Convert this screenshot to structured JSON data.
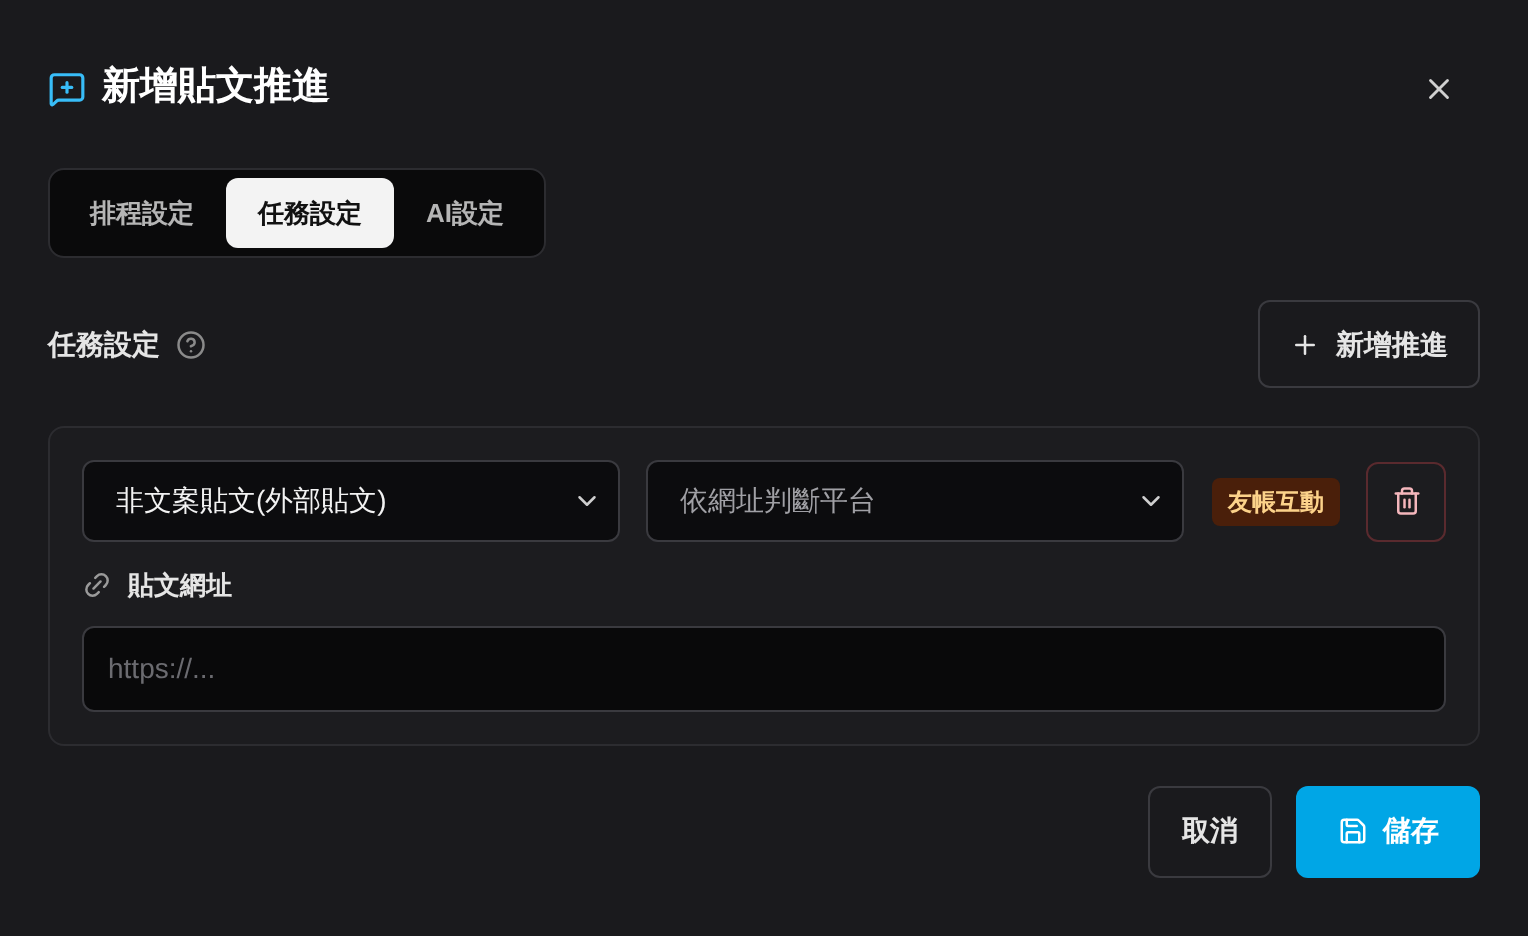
{
  "dialog": {
    "title": "新增貼文推進"
  },
  "tabs": [
    {
      "label": "排程設定",
      "selected": false
    },
    {
      "label": "任務設定",
      "selected": true
    },
    {
      "label": "AI設定",
      "selected": false
    }
  ],
  "section": {
    "title": "任務設定",
    "add_button": "新增推進"
  },
  "tasks": [
    {
      "type_select": {
        "value": "非文案貼文(外部貼文)"
      },
      "platform_select": {
        "placeholder": "依網址判斷平台"
      },
      "badge": "友帳互動",
      "url_label": "貼文網址",
      "url_field": {
        "placeholder": "https://..."
      }
    }
  ],
  "buttons": {
    "cancel": "取消",
    "save": "儲存"
  }
}
